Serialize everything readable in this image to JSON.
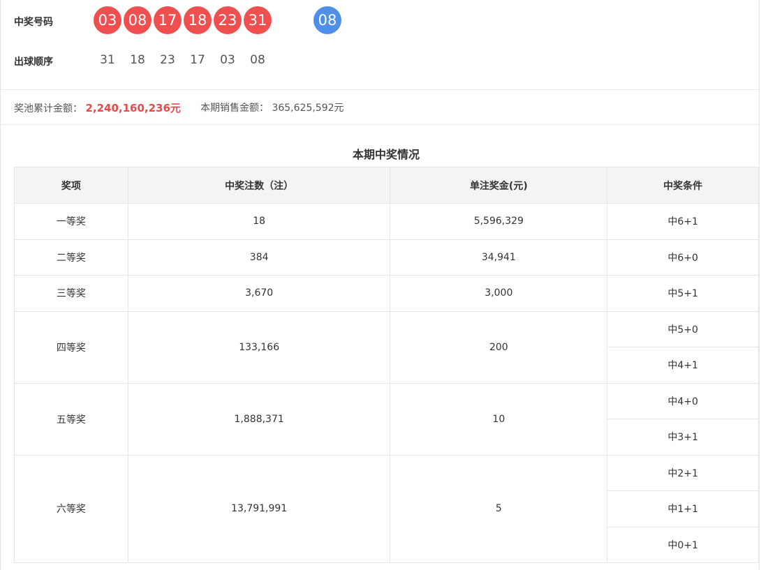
{
  "draw": {
    "winning_label": "中奖号码",
    "red_balls": [
      "03",
      "08",
      "17",
      "18",
      "23",
      "31"
    ],
    "blue_ball": "08",
    "order_label": "出球顺序",
    "order_balls": [
      "31",
      "18",
      "23",
      "17",
      "03",
      "08"
    ]
  },
  "pool": {
    "pool_label": "奖池累计金额：",
    "pool_value": "2,240,160,236元",
    "sales_label": "本期销售金额：",
    "sales_value": "365,625,592元"
  },
  "prizes": {
    "title": "本期中奖情况",
    "headers": [
      "奖项",
      "中奖注数（注）",
      "单注奖金(元)",
      "中奖条件"
    ],
    "rows": [
      {
        "name": "一等奖",
        "count": "18",
        "amount": "5,596,329",
        "conditions": [
          "中6+1"
        ]
      },
      {
        "name": "二等奖",
        "count": "384",
        "amount": "34,941",
        "conditions": [
          "中6+0"
        ]
      },
      {
        "name": "三等奖",
        "count": "3,670",
        "amount": "3,000",
        "conditions": [
          "中5+1"
        ]
      },
      {
        "name": "四等奖",
        "count": "133,166",
        "amount": "200",
        "conditions": [
          "中5+0",
          "中4+1"
        ]
      },
      {
        "name": "五等奖",
        "count": "1,888,371",
        "amount": "10",
        "conditions": [
          "中4+0",
          "中3+1"
        ]
      },
      {
        "name": "六等奖",
        "count": "13,791,991",
        "amount": "5",
        "conditions": [
          "中2+1",
          "中1+1",
          "中0+1"
        ]
      }
    ]
  },
  "colors": {
    "red_ball": "#ef4f4f",
    "blue_ball": "#4f8fe8",
    "highlight": "#e84a4a"
  }
}
